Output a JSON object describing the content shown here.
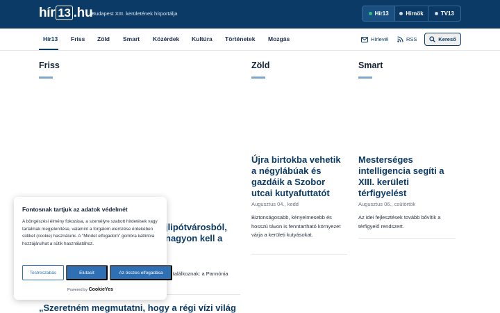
{
  "header": {
    "logo": {
      "prefix": "hír",
      "num": "13",
      "suffix": ".hu"
    },
    "tagline": "Budapest XIII. kerületének hírportálja",
    "channels": [
      {
        "label": "Hír13",
        "dot_color": "#2ec27e"
      },
      {
        "label": "Hírnök",
        "dot_color": "#cfd9e4"
      },
      {
        "label": "TV13",
        "dot_color": "#cfd9e4"
      }
    ]
  },
  "nav": {
    "items": [
      "Hír13",
      "Friss",
      "Zöld",
      "Smart",
      "Közérdek",
      "Kultúra",
      "Történetek",
      "Mozgás"
    ],
    "newsletter": "Hírlevél",
    "rss": "RSS",
    "search": "Kereső"
  },
  "sections": {
    "friss": {
      "title": "Friss",
      "partial_title_1": "jlipótvárosból,",
      "partial_title_2": "nagyon kell a",
      "partial_lead": "or találkoznak: a Pannónia",
      "bottom_title": "„Szeretném megmutatni, hogy a régi vízi világ"
    },
    "zold": {
      "title": "Zöld",
      "article": {
        "title": "Újra birtokba vehetik a négylábúak és gazdáik a Szobor utcai kutyafuttatót",
        "date": "Augusztus 04., kedd",
        "lead": "Biztonságosabb, kényelmesebb és hosszú távon is fenntartható környezet várja a kerületi kutyásokat."
      }
    },
    "smart": {
      "title": "Smart",
      "article": {
        "title": "Mesterséges intelligencia segíti a XIII. kerületi térfigyelést",
        "date": "Augusztus 06., csütörtök",
        "lead": "Az idei fejlesztések tovább bővítik a térfigyelő rendszert."
      }
    }
  },
  "cookie": {
    "title": "Fontosnak tartjuk az adatok védelmét",
    "text": "A böngészési élmény fokozása, a személyre szabott hirdetések vagy tartalmak megjelenítése, valamint a forgalom elemzése érdekében sütiket (cookie) használunk. A \"Mindet elfogadom\" gombra kattintva hozzájárulhat a sütik használatához.",
    "customize": "Testreszabás",
    "reject": "Elutasít",
    "accept": "Az összes elfogadása",
    "powered_by": "Powered by",
    "brand": "CookieYes"
  },
  "colors": {
    "brand": "#0b3a66",
    "accent": "#2f6fb3"
  }
}
